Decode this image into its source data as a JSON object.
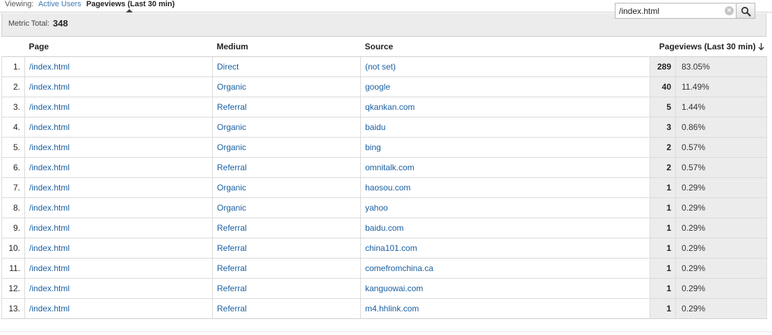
{
  "viewing": {
    "label": "Viewing:",
    "options": [
      "Active Users",
      "Pageviews (Last 30 min)"
    ],
    "selected": "Pageviews (Last 30 min)"
  },
  "metric": {
    "label": "Metric Total:",
    "value": "348"
  },
  "search": {
    "value": "/index.html",
    "clear_icon": "clear-icon",
    "button_icon": "search-icon"
  },
  "table": {
    "columns": [
      "Page",
      "Medium",
      "Source",
      "Pageviews (Last 30 min)"
    ],
    "sort_icon": "arrow-down-icon",
    "rows": [
      {
        "n": "1.",
        "page": "/index.html",
        "medium": "Direct",
        "source": "(not set)",
        "pv": "289",
        "pct": "83.05%"
      },
      {
        "n": "2.",
        "page": "/index.html",
        "medium": "Organic",
        "source": "google",
        "pv": "40",
        "pct": "11.49%"
      },
      {
        "n": "3.",
        "page": "/index.html",
        "medium": "Referral",
        "source": "qkankan.com",
        "pv": "5",
        "pct": "1.44%"
      },
      {
        "n": "4.",
        "page": "/index.html",
        "medium": "Organic",
        "source": "baidu",
        "pv": "3",
        "pct": "0.86%"
      },
      {
        "n": "5.",
        "page": "/index.html",
        "medium": "Organic",
        "source": "bing",
        "pv": "2",
        "pct": "0.57%"
      },
      {
        "n": "6.",
        "page": "/index.html",
        "medium": "Referral",
        "source": "omnitalk.com",
        "pv": "2",
        "pct": "0.57%"
      },
      {
        "n": "7.",
        "page": "/index.html",
        "medium": "Organic",
        "source": "haosou.com",
        "pv": "1",
        "pct": "0.29%"
      },
      {
        "n": "8.",
        "page": "/index.html",
        "medium": "Organic",
        "source": "yahoo",
        "pv": "1",
        "pct": "0.29%"
      },
      {
        "n": "9.",
        "page": "/index.html",
        "medium": "Referral",
        "source": "baidu.com",
        "pv": "1",
        "pct": "0.29%"
      },
      {
        "n": "10.",
        "page": "/index.html",
        "medium": "Referral",
        "source": "china101.com",
        "pv": "1",
        "pct": "0.29%"
      },
      {
        "n": "11.",
        "page": "/index.html",
        "medium": "Referral",
        "source": "comefromchina.ca",
        "pv": "1",
        "pct": "0.29%"
      },
      {
        "n": "12.",
        "page": "/index.html",
        "medium": "Referral",
        "source": "kanguowai.com",
        "pv": "1",
        "pct": "0.29%"
      },
      {
        "n": "13.",
        "page": "/index.html",
        "medium": "Referral",
        "source": "m4.hhlink.com",
        "pv": "1",
        "pct": "0.29%"
      }
    ]
  },
  "colors": {
    "link": "#1a5ea0",
    "header_bg": "#ececec",
    "border": "#dadada"
  }
}
